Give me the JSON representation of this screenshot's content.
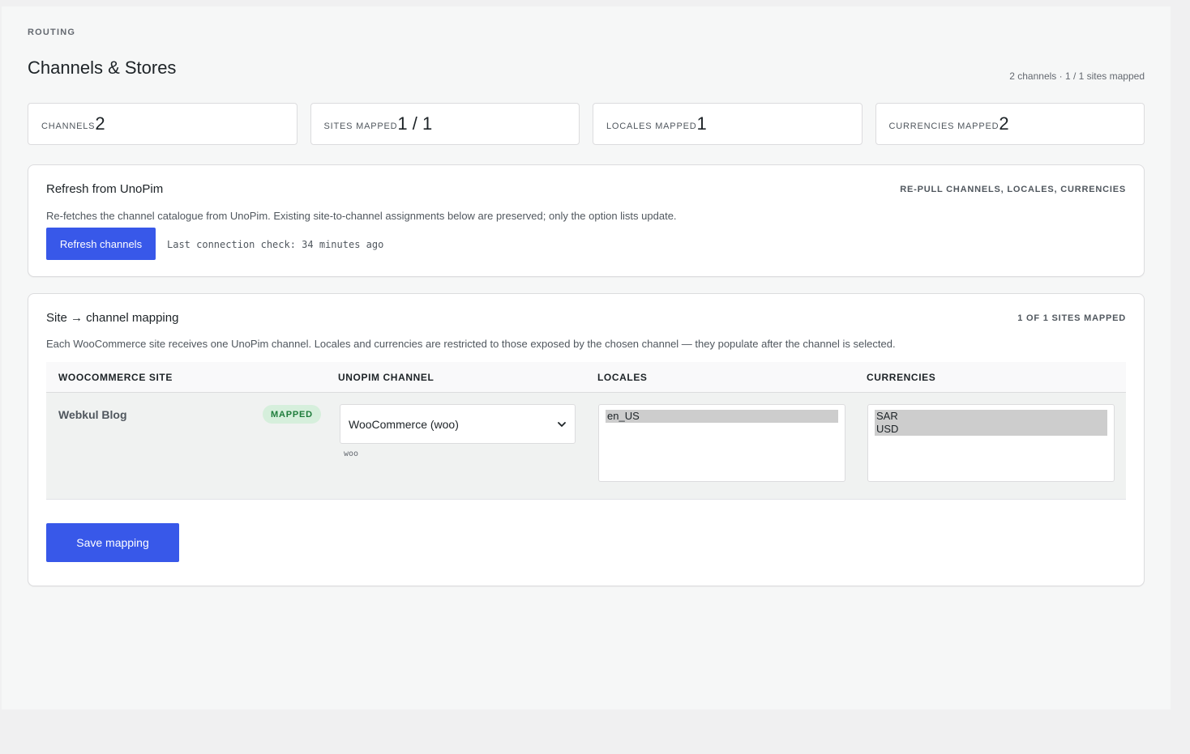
{
  "header": {
    "eyebrow": "ROUTING",
    "title": "Channels & Stores",
    "summary": "2 channels · 1 / 1 sites mapped"
  },
  "stats": [
    {
      "label": "Channels",
      "value": "2"
    },
    {
      "label": "Sites mapped",
      "value": "1 / 1"
    },
    {
      "label": "Locales mapped",
      "value": "1"
    },
    {
      "label": "Currencies mapped",
      "value": "2"
    }
  ],
  "refresh_card": {
    "title": "Refresh from UnoPim",
    "meta": "RE-PULL CHANNELS, LOCALES, CURRENCIES",
    "description": "Re-fetches the channel catalogue from UnoPim. Existing site-to-channel assignments below are preserved; only the option lists update.",
    "button_label": "Refresh channels",
    "check_text": "Last connection check: 34 minutes ago"
  },
  "mapping_card": {
    "title": "Site → channel mapping",
    "meta": "1 OF 1 SITES MAPPED",
    "description": "Each WooCommerce site receives one UnoPim channel. Locales and currencies are restricted to those exposed by the chosen channel — they populate after the channel is selected.",
    "columns": [
      "WooCommerce site",
      "UnoPim channel",
      "Locales",
      "Currencies"
    ],
    "rows": [
      {
        "site": "Webkul Blog",
        "badge": "MAPPED",
        "channel": "WooCommerce (woo)",
        "channel_code": "woo",
        "locales": [
          "en_US"
        ],
        "currencies": [
          "SAR",
          "USD"
        ]
      }
    ],
    "save_label": "Save mapping"
  },
  "colors": {
    "primary": "#3858e9",
    "badge_bg": "#d6efdc",
    "badge_text": "#1e7c3b"
  }
}
